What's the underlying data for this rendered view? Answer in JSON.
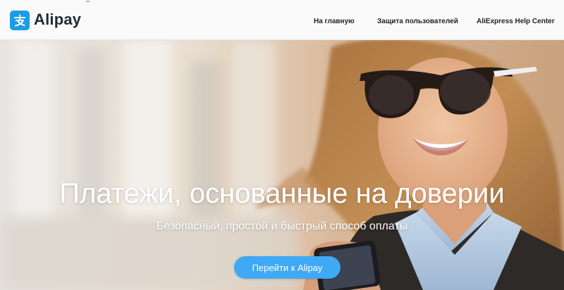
{
  "header": {
    "logo_text": "Alipay",
    "logo_tm": "™",
    "logo_icon": "alipay-zhi-icon",
    "nav": [
      {
        "label": "На главную"
      },
      {
        "label": "Защита пользователей"
      },
      {
        "label": "AliExpress Help Center"
      }
    ]
  },
  "hero": {
    "headline": "Платежи, основанные на доверии",
    "subline": "Безопасный, простой и быстрый способ оплаты",
    "cta_label": "Перейти к Alipay"
  },
  "colors": {
    "brand": "#1b9ce6",
    "cta": "#3fa9f5",
    "header_bg": "#fafafa",
    "nav_text": "#222222"
  }
}
